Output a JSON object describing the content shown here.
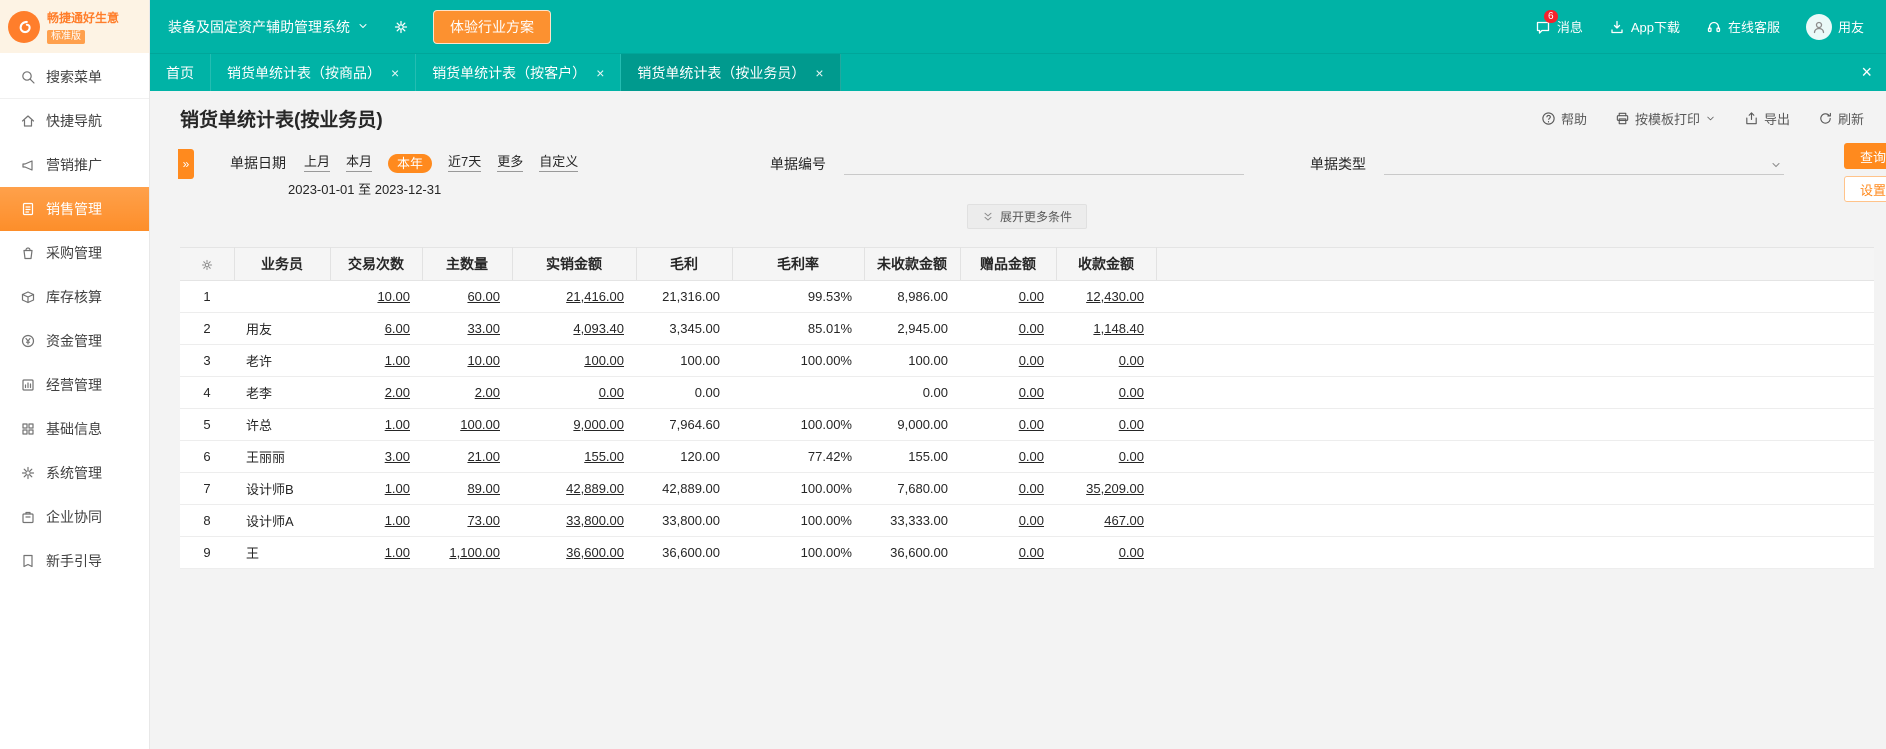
{
  "colors": {
    "teal": "#00b3a6",
    "teal_dark": "#009a8e",
    "orange": "#ff8a1e",
    "badge_red": "#f5222d",
    "sidebar_active": "#fd8e2a"
  },
  "icons": {
    "search-icon": "magnifier",
    "home-icon": "house",
    "megaphone-icon": "announce",
    "doc-icon": "document",
    "bag-icon": "shopping-bag",
    "box-icon": "package",
    "coin-icon": "yuan-coin",
    "chart-icon": "bar-chart",
    "grid-icon": "grid",
    "gear-icon": "⚙",
    "people-icon": "people",
    "book-icon": "book",
    "chevron-down-icon": "⌄",
    "close-icon": "×",
    "message-icon": "chat-bubble",
    "download-icon": "⭳",
    "headset-icon": "headset",
    "avatar-icon": "person",
    "help-icon": "?-circle",
    "printer-icon": "printer",
    "export-icon": "arrow-out-of-box",
    "refresh-icon": "↻",
    "double-chevron-down-icon": "⌄⌄",
    "collapse-icon": "»"
  },
  "logo": {
    "name": "畅捷通好生意",
    "edition": "标准版"
  },
  "topbar": {
    "system_select": "装备及固定资产辅助管理系统",
    "trial_button": "体验行业方案",
    "messages": "消息",
    "messages_badge": "6",
    "app_download": "App下载",
    "online_service": "在线客服",
    "user": "用友"
  },
  "tabs": [
    {
      "label": "首页",
      "closable": false,
      "active": false
    },
    {
      "label": "销货单统计表（按商品）",
      "closable": true,
      "active": false
    },
    {
      "label": "销货单统计表（按客户）",
      "closable": true,
      "active": false
    },
    {
      "label": "销货单统计表（按业务员）",
      "closable": true,
      "active": true
    }
  ],
  "sidebar": {
    "items": [
      {
        "label": "搜索菜单",
        "icon": "search-icon"
      },
      {
        "label": "快捷导航",
        "icon": "home-icon"
      },
      {
        "label": "营销推广",
        "icon": "megaphone-icon"
      },
      {
        "label": "销售管理",
        "icon": "doc-icon",
        "active": true
      },
      {
        "label": "采购管理",
        "icon": "bag-icon"
      },
      {
        "label": "库存核算",
        "icon": "box-icon"
      },
      {
        "label": "资金管理",
        "icon": "coin-icon"
      },
      {
        "label": "经营管理",
        "icon": "chart-icon"
      },
      {
        "label": "基础信息",
        "icon": "grid-icon"
      },
      {
        "label": "系统管理",
        "icon": "gear-icon"
      },
      {
        "label": "企业协同",
        "icon": "people-icon"
      },
      {
        "label": "新手引导",
        "icon": "book-icon"
      }
    ]
  },
  "page": {
    "title": "销货单统计表(按业务员)",
    "toolbar": {
      "help": "帮助",
      "print": "按模板打印",
      "export": "导出",
      "refresh": "刷新"
    }
  },
  "filters": {
    "date_label": "单据日期",
    "quick_options": [
      "上月",
      "本月",
      "本年",
      "近7天",
      "更多",
      "自定义"
    ],
    "active_quick": "本年",
    "date_range": "2023-01-01 至 2023-12-31",
    "doc_no_label": "单据编号",
    "doc_no_value": "",
    "doc_type_label": "单据类型",
    "doc_type_value": "",
    "expand_more": "展开更多条件",
    "search_button": "查询",
    "settings_button": "设置"
  },
  "table": {
    "columns": [
      "业务员",
      "交易次数",
      "主数量",
      "实销金额",
      "毛利",
      "毛利率",
      "未收款金额",
      "赠品金额",
      "收款金额"
    ],
    "column_keys": [
      "trades",
      "qty",
      "sales-amount",
      "gross-profit",
      "margin",
      "unpaid",
      "gift-amount",
      "received"
    ],
    "link_columns": [
      0,
      1,
      2,
      6,
      7
    ],
    "rows": [
      {
        "no": "1",
        "name": "",
        "values": [
          "10.00",
          "60.00",
          "21,416.00",
          "21,316.00",
          "99.53%",
          "8,986.00",
          "0.00",
          "12,430.00"
        ]
      },
      {
        "no": "2",
        "name": "用友",
        "values": [
          "6.00",
          "33.00",
          "4,093.40",
          "3,345.00",
          "85.01%",
          "2,945.00",
          "0.00",
          "1,148.40"
        ]
      },
      {
        "no": "3",
        "name": "老许",
        "values": [
          "1.00",
          "10.00",
          "100.00",
          "100.00",
          "100.00%",
          "100.00",
          "0.00",
          "0.00"
        ]
      },
      {
        "no": "4",
        "name": "老李",
        "values": [
          "2.00",
          "2.00",
          "0.00",
          "0.00",
          "",
          "0.00",
          "0.00",
          "0.00"
        ]
      },
      {
        "no": "5",
        "name": "许总",
        "values": [
          "1.00",
          "100.00",
          "9,000.00",
          "7,964.60",
          "100.00%",
          "9,000.00",
          "0.00",
          "0.00"
        ]
      },
      {
        "no": "6",
        "name": "王丽丽",
        "values": [
          "3.00",
          "21.00",
          "155.00",
          "120.00",
          "77.42%",
          "155.00",
          "0.00",
          "0.00"
        ]
      },
      {
        "no": "7",
        "name": "设计师B",
        "values": [
          "1.00",
          "89.00",
          "42,889.00",
          "42,889.00",
          "100.00%",
          "7,680.00",
          "0.00",
          "35,209.00"
        ]
      },
      {
        "no": "8",
        "name": "设计师A",
        "values": [
          "1.00",
          "73.00",
          "33,800.00",
          "33,800.00",
          "100.00%",
          "33,333.00",
          "0.00",
          "467.00"
        ]
      },
      {
        "no": "9",
        "name": "王",
        "values": [
          "1.00",
          "1,100.00",
          "36,600.00",
          "36,600.00",
          "100.00%",
          "36,600.00",
          "0.00",
          "0.00"
        ]
      }
    ]
  }
}
